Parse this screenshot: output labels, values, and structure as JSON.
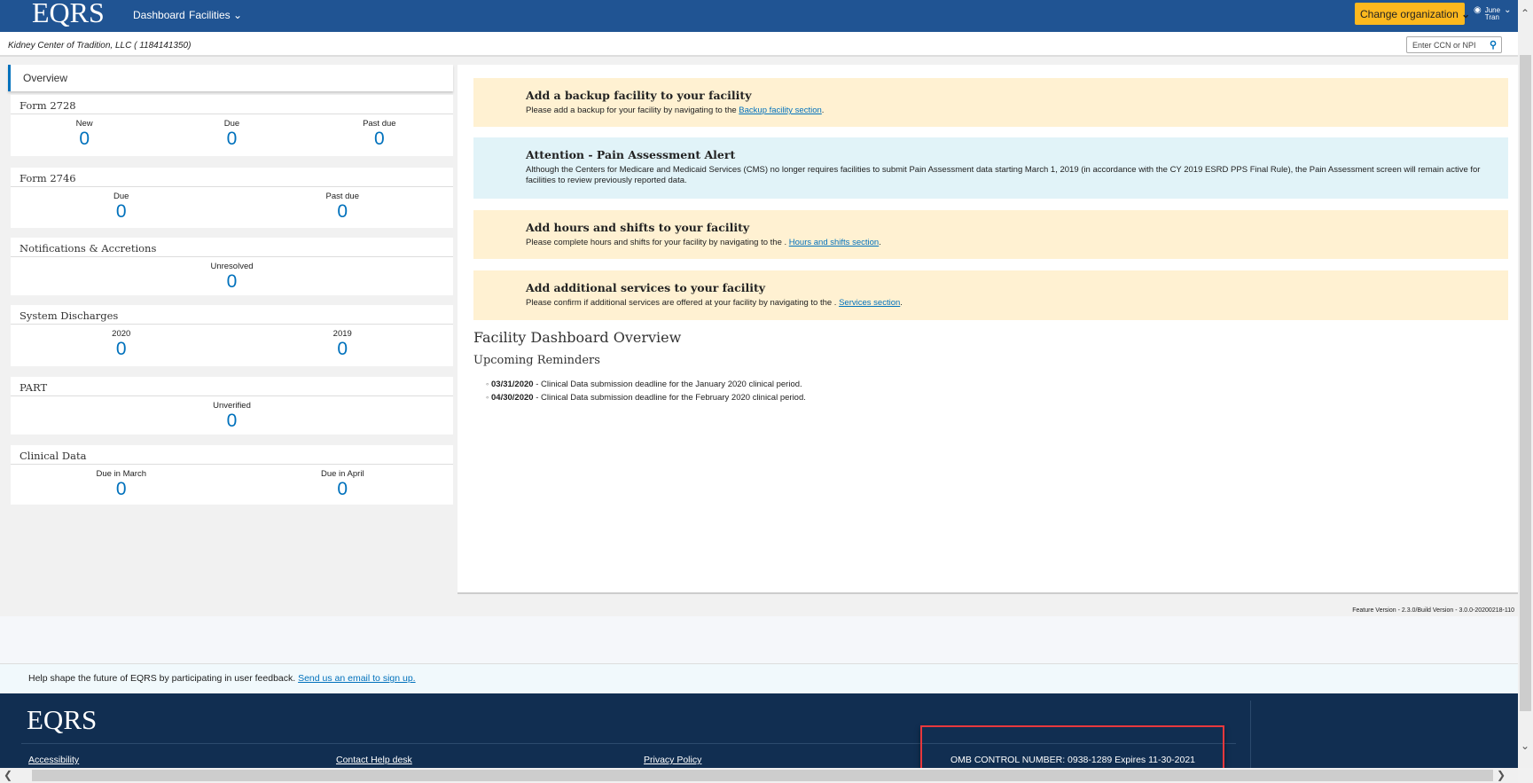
{
  "header": {
    "logo": "EQRS",
    "nav": [
      "Dashboard",
      "Facilities"
    ],
    "change_org": "Change organization",
    "user_first": "June",
    "user_last": "Tran"
  },
  "subheader": {
    "organization": "Kidney Center of Tradition, LLC ( 1184141350)",
    "search_placeholder": "Enter CCN or NPI"
  },
  "sidebar": {
    "tab": "Overview",
    "cards": [
      {
        "title": "Form 2728",
        "cells": [
          {
            "label": "New",
            "value": "0"
          },
          {
            "label": "Due",
            "value": "0"
          },
          {
            "label": "Past due",
            "value": "0"
          }
        ]
      },
      {
        "title": "Form 2746",
        "cells": [
          {
            "label": "Due",
            "value": "0"
          },
          {
            "label": "Past due",
            "value": "0"
          }
        ]
      },
      {
        "title": "Notifications & Accretions",
        "cells": [
          {
            "label": "Unresolved",
            "value": "0"
          }
        ]
      },
      {
        "title": "System Discharges",
        "cells": [
          {
            "label": "2020",
            "value": "0"
          },
          {
            "label": "2019",
            "value": "0"
          }
        ]
      },
      {
        "title": "PART",
        "cells": [
          {
            "label": "Unverified",
            "value": "0"
          }
        ]
      },
      {
        "title": "Clinical Data",
        "cells": [
          {
            "label": "Due in March",
            "value": "0"
          },
          {
            "label": "Due in April",
            "value": "0"
          }
        ]
      }
    ]
  },
  "alerts": [
    {
      "title": "Add a backup facility to your facility",
      "text": "Please add a backup for your facility by navigating to the ",
      "link": "Backup facility section",
      "end": "."
    },
    {
      "title": "Attention - Pain Assessment Alert",
      "text": "Although the Centers for Medicare and Medicaid Services (CMS) no longer requires facilities to submit Pain Assessment data starting March 1, 2019 (in accordance with the CY 2019 ESRD PPS Final Rule), the Pain Assessment screen will remain active for facilities to review previously reported data."
    },
    {
      "title": "Add hours and shifts to your facility",
      "text": "Please complete hours and shifts for your facility by navigating to the . ",
      "link": "Hours and shifts section",
      "end": "."
    },
    {
      "title": "Add additional services to your facility",
      "text": "Please confirm if additional services are offered at your facility by navigating to the . ",
      "link": "Services section",
      "end": "."
    }
  ],
  "main": {
    "title": "Facility Dashboard Overview",
    "subtitle": "Upcoming Reminders",
    "reminders": [
      {
        "date": "03/31/2020",
        "text": " -  Clinical Data submission deadline for the January 2020 clinical period."
      },
      {
        "date": "04/30/2020",
        "text": " -  Clinical Data submission deadline for the February 2020 clinical period."
      }
    ]
  },
  "version": "Feature Version - 2.3.0/Build Version - 3.0.0-20200218-110",
  "feedback": {
    "text": "Help shape the future of EQRS by participating in user feedback. ",
    "link": "Send us an email to sign up."
  },
  "footer": {
    "logo": "EQRS",
    "links": [
      "Accessibility",
      "Contact Help desk",
      "Privacy Policy"
    ],
    "omb": "OMB CONTROL NUMBER: 0938-1289 Expires 11-30-2021"
  },
  "colors": {
    "header": "#205493",
    "accent": "#0071bc",
    "button": "#fdb81e",
    "footer": "#112e51",
    "highlight": "#e8383d"
  }
}
